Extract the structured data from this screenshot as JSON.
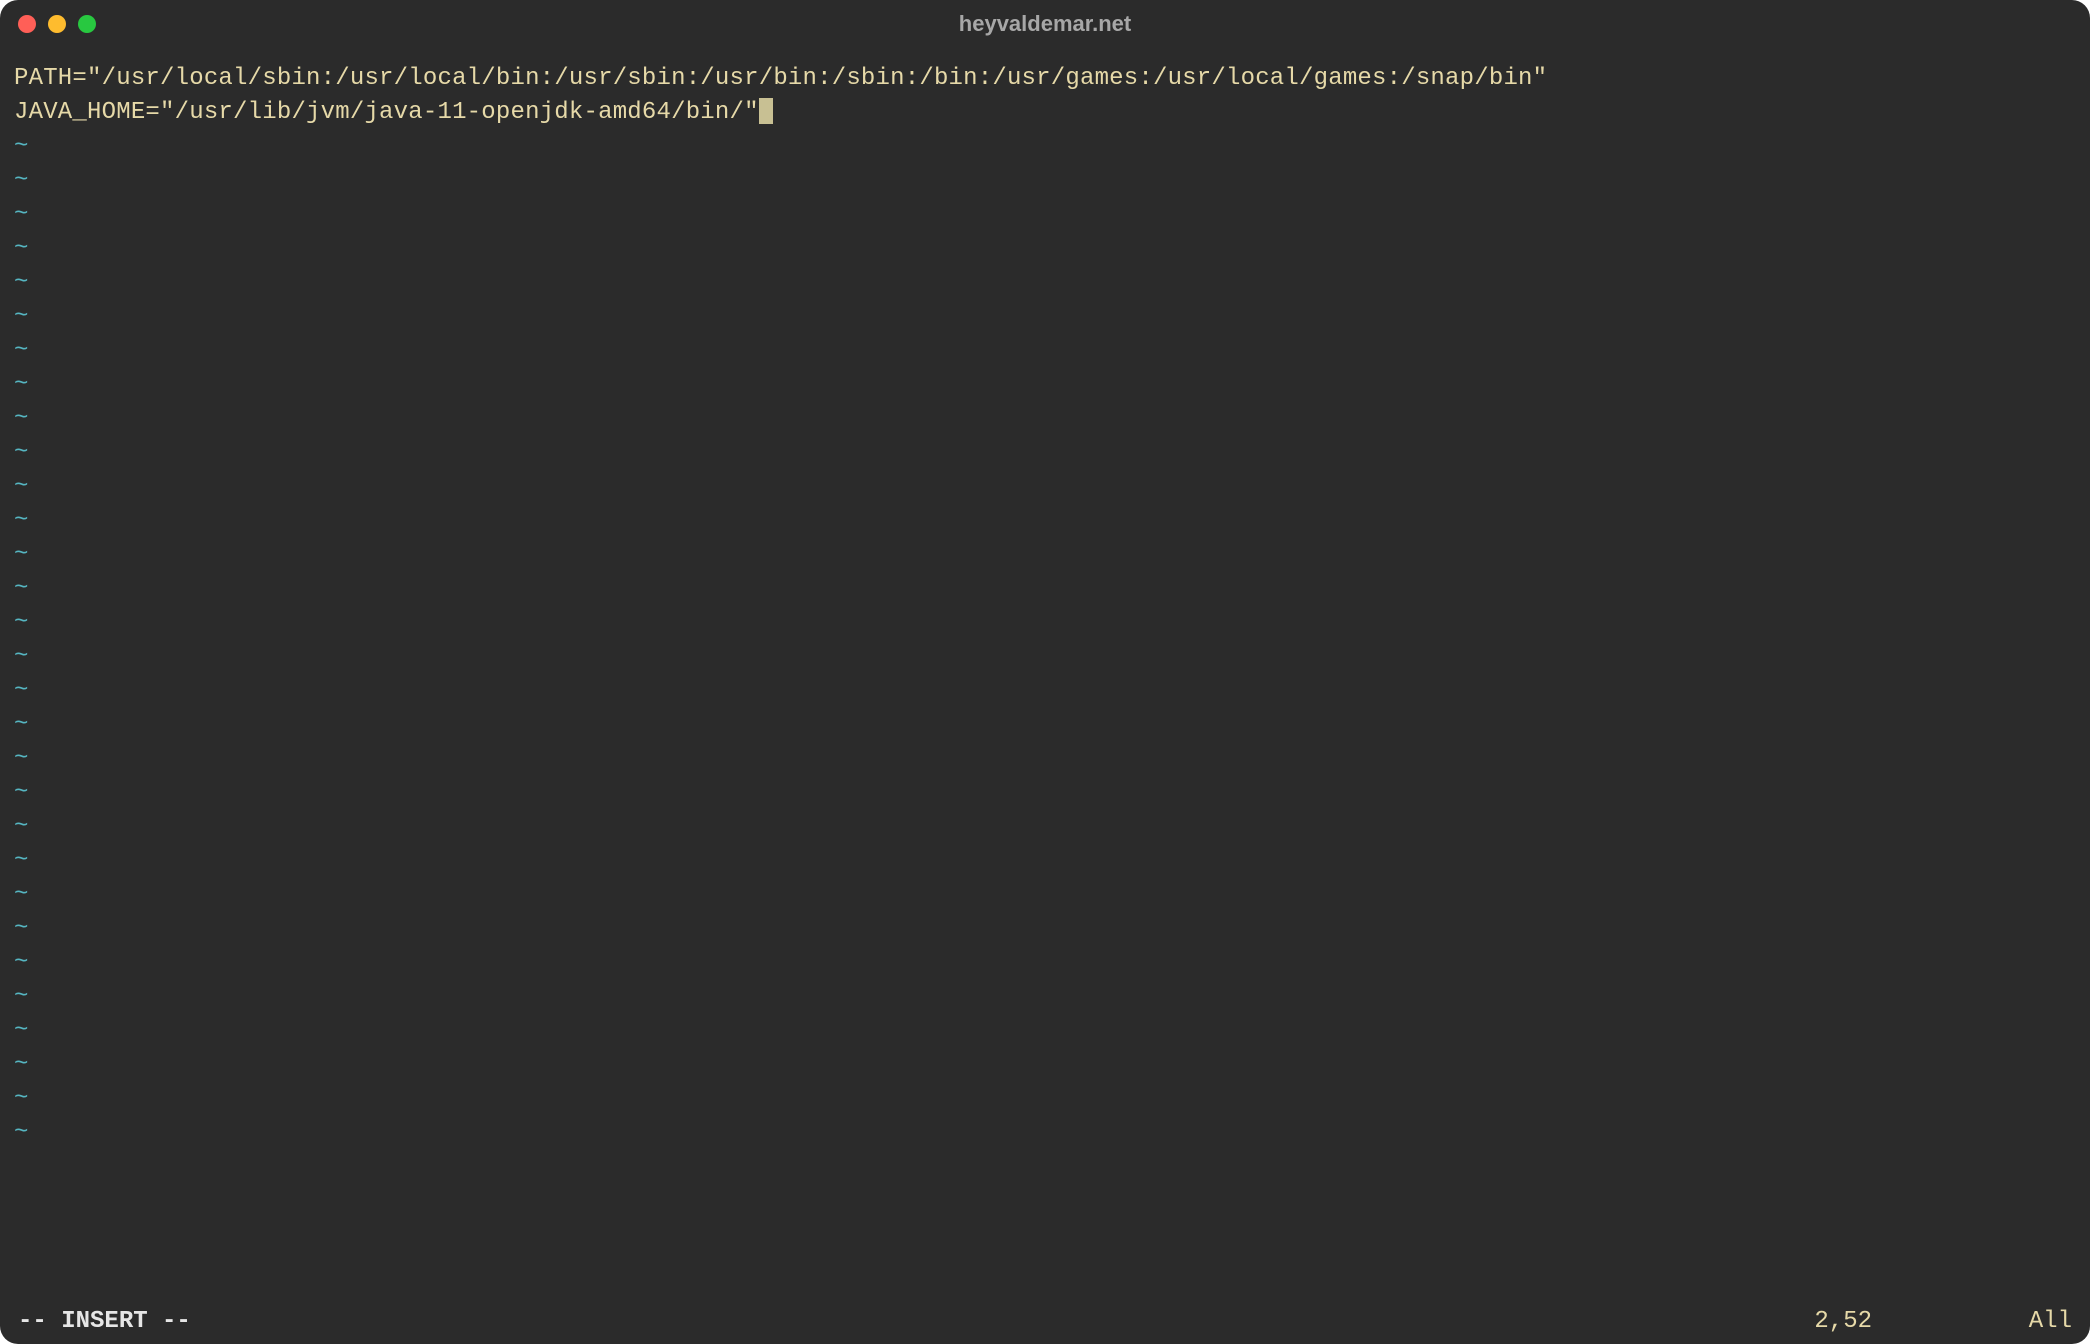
{
  "window": {
    "title": "heyvaldemar.net"
  },
  "editor": {
    "line1": "PATH=\"/usr/local/sbin:/usr/local/bin:/usr/sbin:/usr/bin:/sbin:/bin:/usr/games:/usr/local/games:/snap/bin\"",
    "line2": "JAVA_HOME=\"/usr/lib/jvm/java-11-openjdk-amd64/bin/\"",
    "empty_marker": "~",
    "empty_count": 30
  },
  "status": {
    "mode": "-- INSERT --",
    "position": "2,52",
    "scroll": "All"
  }
}
